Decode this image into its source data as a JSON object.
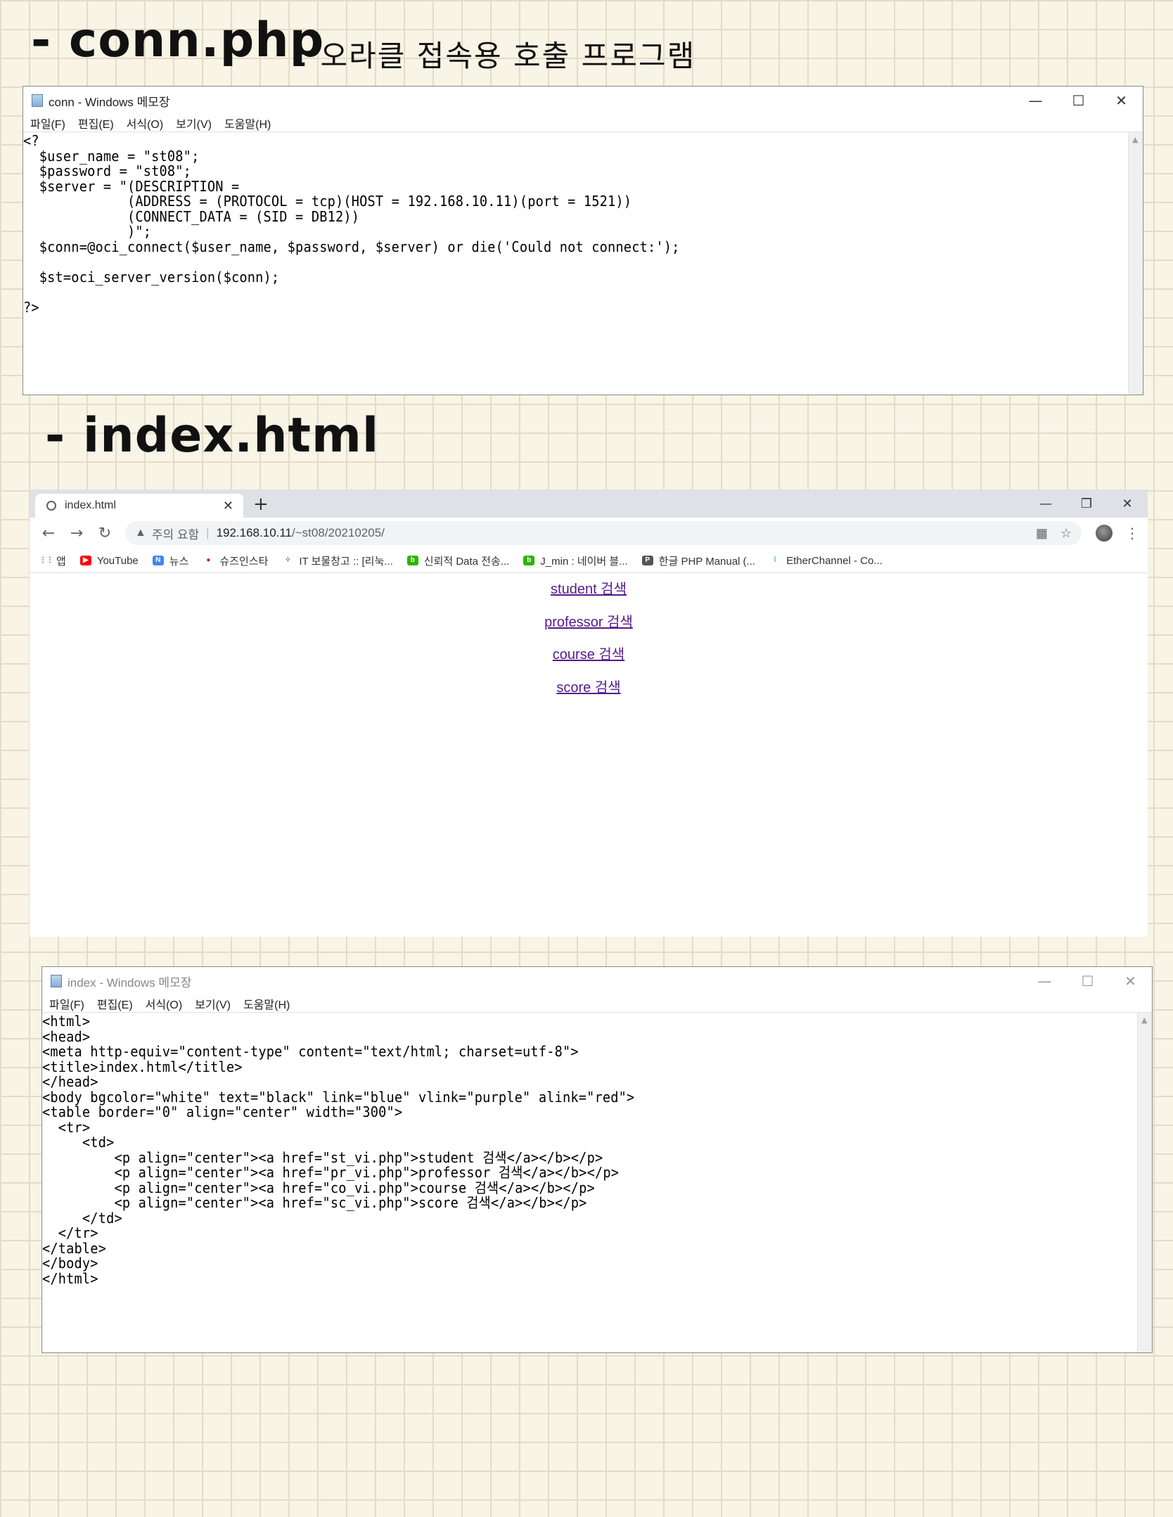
{
  "annotations": {
    "conn_heading": "- conn.php",
    "conn_subtitle": ": 오라클 접속용 호출 프로그램",
    "index_heading": "- index.html"
  },
  "notepad_conn": {
    "title": "conn - Windows 메모장",
    "menu": [
      "파일(F)",
      "편집(E)",
      "서식(O)",
      "보기(V)",
      "도움말(H)"
    ],
    "controls": {
      "minimize": "—",
      "maximize": "☐",
      "close": "✕"
    },
    "content": "<?\n  $user_name = \"st08\";\n  $password = \"st08\";\n  $server = \"(DESCRIPTION =\n             (ADDRESS = (PROTOCOL = tcp)(HOST = 192.168.10.11)(port = 1521))\n             (CONNECT_DATA = (SID = DB12))\n             )\";\n  $conn=@oci_connect($user_name, $password, $server) or die('Could not connect:');\n\n  $st=oci_server_version($conn);\n\n?>"
  },
  "browser": {
    "tab_title": "index.html",
    "tab_close": "✕",
    "new_tab": "+",
    "controls": {
      "minimize": "—",
      "restore": "❐",
      "close": "✕"
    },
    "nav": {
      "back": "←",
      "forward": "→",
      "reload": "↻"
    },
    "security_icon": "▲",
    "security_label": "주의 요함",
    "separator": "|",
    "url_host": "192.168.10.11",
    "url_path": "/~st08/20210205/",
    "omnibox_icons": {
      "qr": "▦",
      "star": "☆"
    },
    "menu_icon": "⋮",
    "bookmarks": [
      {
        "label": "앱",
        "icon": "apps",
        "color": "#d93025"
      },
      {
        "label": "YouTube",
        "icon": "youtube",
        "color": "#ff0000"
      },
      {
        "label": "뉴스",
        "icon": "news",
        "color": "#4285f4"
      },
      {
        "label": "슈즈인스타",
        "icon": "circle",
        "color": "#c5221f"
      },
      {
        "label": "IT 보물창고 :: [리눅...",
        "icon": "dots",
        "color": "#333333"
      },
      {
        "label": "신뢰적 Data 전송...",
        "icon": "blog",
        "color": "#2db400"
      },
      {
        "label": "J_min : 네이버 블...",
        "icon": "blog",
        "color": "#2db400"
      },
      {
        "label": "한글 PHP Manual (...",
        "icon": "php",
        "color": "#555555"
      },
      {
        "label": "EtherChannel - Co...",
        "icon": "cisco",
        "color": "#049fd9"
      }
    ],
    "links": [
      "student 검색",
      "professor 검색",
      "course 검색",
      "score 검색"
    ],
    "link_color": "#551a8b"
  },
  "notepad_index": {
    "title": "index - Windows 메모장",
    "menu": [
      "파일(F)",
      "편집(E)",
      "서식(O)",
      "보기(V)",
      "도움말(H)"
    ],
    "controls": {
      "minimize": "—",
      "maximize": "☐",
      "close": "✕"
    },
    "content": "<html>\n<head>\n<meta http-equiv=\"content-type\" content=\"text/html; charset=utf-8\">\n<title>index.html</title>\n</head>\n<body bgcolor=\"white\" text=\"black\" link=\"blue\" vlink=\"purple\" alink=\"red\">\n<table border=\"0\" align=\"center\" width=\"300\">\n  <tr>\n     <td>\n         <p align=\"center\"><a href=\"st_vi.php\">student 검색</a></b></p>\n         <p align=\"center\"><a href=\"pr_vi.php\">professor 검색</a></b></p>\n         <p align=\"center\"><a href=\"co_vi.php\">course 검색</a></b></p>\n         <p align=\"center\"><a href=\"sc_vi.php\">score 검색</a></b></p>\n     </td>\n  </tr>\n</table>\n</body>\n</html>"
  }
}
